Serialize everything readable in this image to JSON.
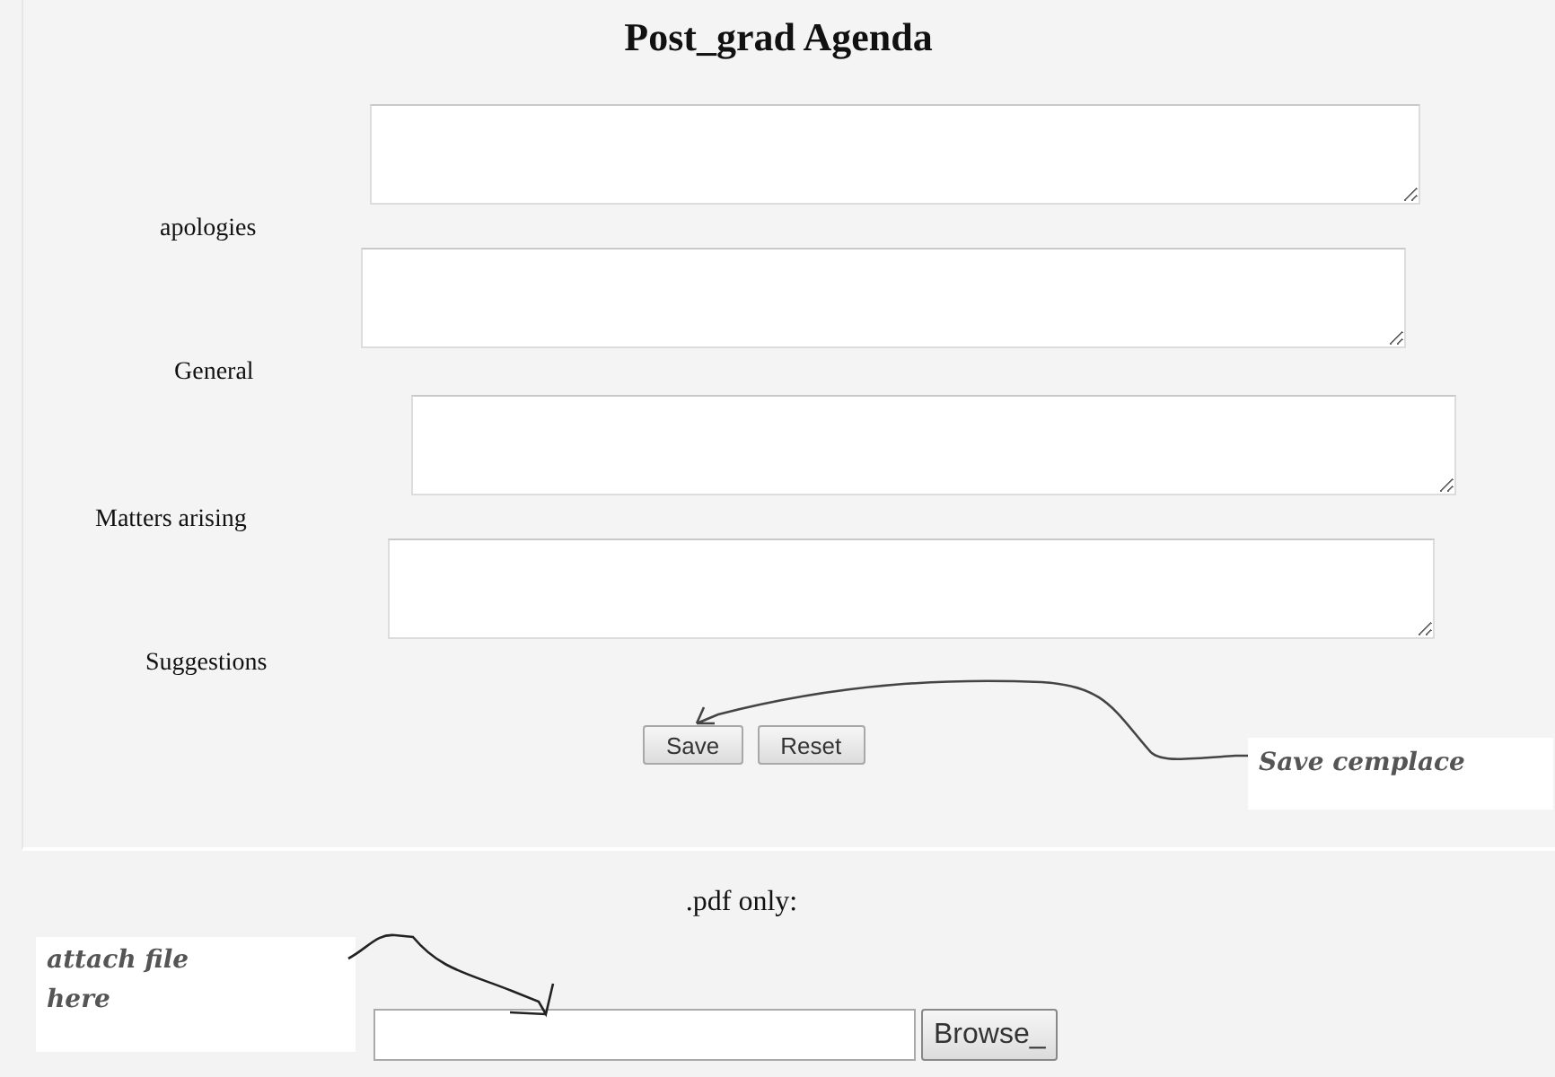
{
  "title": "Post_grad Agenda",
  "fields": [
    {
      "label": "apologies"
    },
    {
      "label": "General"
    },
    {
      "label": "Matters arising"
    },
    {
      "label": "Suggestions"
    }
  ],
  "buttons": [
    "Save",
    "Reset"
  ],
  "upload": {
    "hint": ".pdf only:",
    "button": "Browse_"
  },
  "annotations": [
    {
      "text": "Save cemplace"
    },
    {
      "text": "attach file here"
    }
  ]
}
